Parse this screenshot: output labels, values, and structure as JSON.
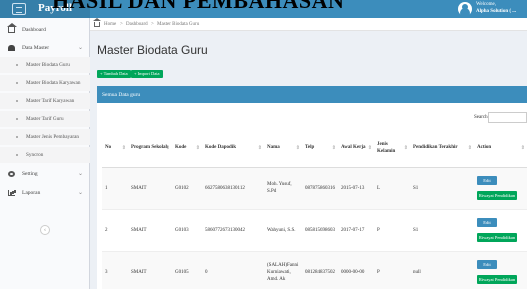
{
  "document": {
    "heading": "HASIL DAN PEMBAHASAN"
  },
  "topbar": {
    "brand_icon": "id-card-icon",
    "brand_label": "Payroll",
    "user": {
      "welcome": "Welcome,",
      "name": "Alpha Solution ( ..."
    }
  },
  "sidebar": {
    "items": [
      {
        "label": "Dashboard",
        "icon": "home-icon"
      },
      {
        "label": "Data Master",
        "icon": "user-icon",
        "chevron": "⌄"
      },
      {
        "label": "Setting",
        "icon": "gear-icon",
        "chevron": "⌄"
      },
      {
        "label": "Laporan",
        "icon": "chart-icon",
        "chevron": "⌄"
      }
    ],
    "subitems": [
      "Master Biodata Guru",
      "Master Biodata Karyawan",
      "Master Tarif Karyawan",
      "Master Tarif Guru",
      "Master Jenis Pembayaran",
      "Syncron"
    ],
    "collapse_glyph": "‹"
  },
  "breadcrumb": {
    "items": [
      "Home",
      "Dashboard",
      "Master Biodata Guru"
    ],
    "separator": ">"
  },
  "page": {
    "title": "Master Biodata Guru",
    "buttons": {
      "add": "Tambah Data",
      "import": "Import Data"
    }
  },
  "box": {
    "header": "Semua Data guru",
    "search_label": "Search:",
    "search_value": ""
  },
  "table": {
    "columns": [
      "No",
      "Program Sekolah",
      "Kode",
      "Kode Dapodik",
      "Nama",
      "Telp",
      "Awal Kerja",
      "Jenis Kelamin",
      "Pendidikan Terakhir",
      "Action"
    ],
    "rows": [
      {
        "no": "1",
        "program": "SMAIT",
        "kode": "G0102",
        "dapodik": "6627580638130112",
        "nama": "Moh. Yusuf, S.Pd",
        "telp": "087875860316",
        "awal": "2015-07-13",
        "jk": "L",
        "pendidikan": "S1"
      },
      {
        "no": "2",
        "program": "SMAIT",
        "kode": "G0103",
        "dapodik": "5860772673130042",
        "nama": "Wahyuni, S.S.",
        "telp": "085815698603",
        "awal": "2017-07-17",
        "jk": "P",
        "pendidikan": "S1"
      },
      {
        "no": "3",
        "program": "SMAIT",
        "kode": "G0105",
        "dapodik": "0",
        "nama": "(SALAH)Fanni Kurniawati, Amd. Ak",
        "telp": "081284837502",
        "awal": "0000-00-00",
        "jk": "P",
        "pendidikan": "null"
      }
    ],
    "actions": {
      "edit": "Edit",
      "history": "Riwayat Pendidikan"
    },
    "sort_glyph": "⇕"
  },
  "colors": {
    "primary": "#3c8dbc",
    "success": "#00a65a",
    "background": "#ecf0f5"
  }
}
